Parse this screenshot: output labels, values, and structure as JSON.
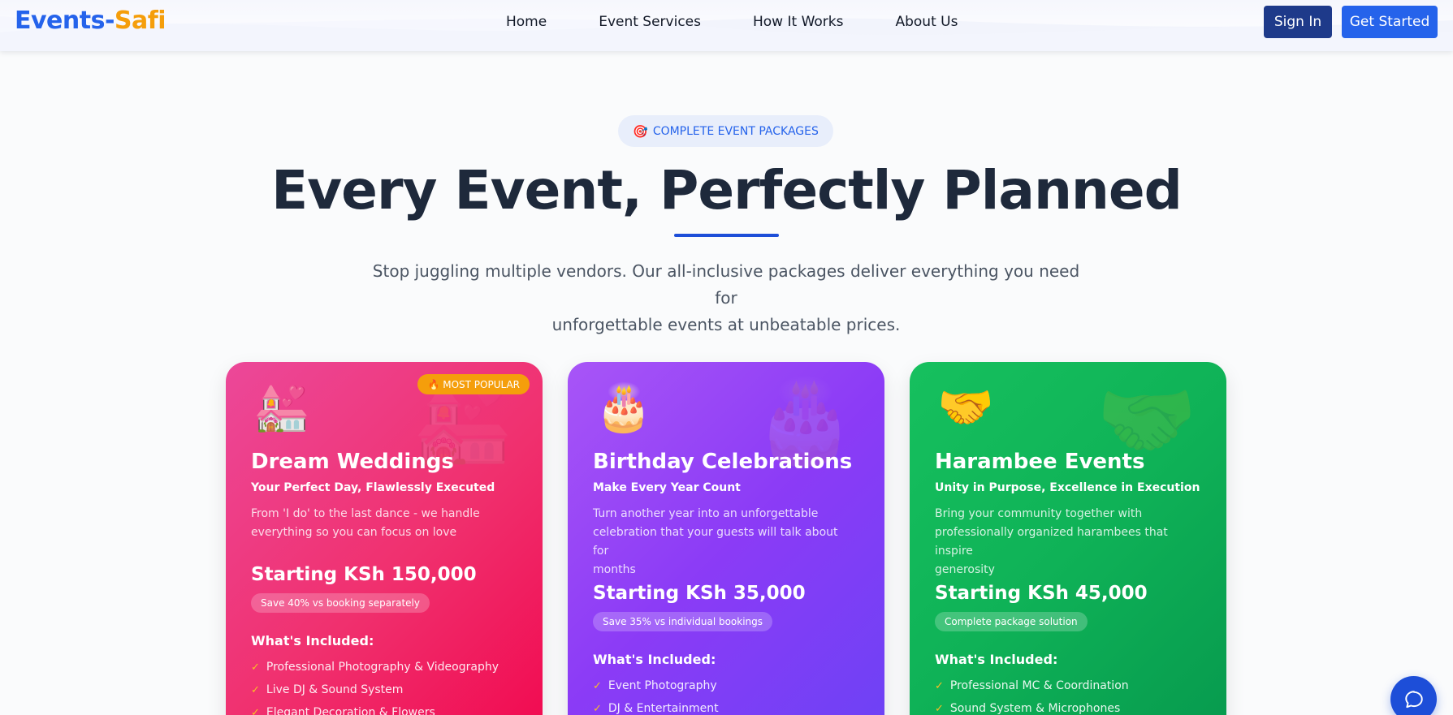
{
  "nav": {
    "logo_part1": "Events-",
    "logo_part2": "Safi",
    "links": [
      "Home",
      "Event Services",
      "How It Works",
      "About Us"
    ],
    "sign_in": "Sign In",
    "get_started": "Get Started"
  },
  "hero": {
    "badge_icon": "🎯",
    "badge_text": "COMPLETE EVENT PACKAGES",
    "title": "Every Event, Perfectly Planned",
    "subtitle_line1": "Stop juggling multiple vendors. Our all-inclusive packages deliver everything you need for",
    "subtitle_line2": "unforgettable events at unbeatable prices."
  },
  "cards": [
    {
      "emoji": "💒",
      "badge": "🔥 MOST POPULAR",
      "title": "Dream Weddings",
      "tagline": "Your Perfect Day, Flawlessly Executed",
      "desc_line1": "From 'I do' to the last dance - we handle",
      "desc_line2": "everything so you can focus on love",
      "desc_line3": "",
      "price": "Starting KSh 150,000",
      "save": "Save 40% vs booking separately",
      "included_label": "What's Included:",
      "items": [
        "Professional Photography & Videography",
        "Live DJ & Sound System",
        "Elegant Decoration & Flowers"
      ]
    },
    {
      "emoji": "🎂",
      "badge": "",
      "title": "Birthday Celebrations",
      "tagline": "Make Every Year Count",
      "desc_line1": "Turn another year into an unforgettable",
      "desc_line2": "celebration that your guests will talk about for",
      "desc_line3": "months",
      "price": "Starting KSh 35,000",
      "save": "Save 35% vs individual bookings",
      "included_label": "What's Included:",
      "items": [
        "Event Photography",
        "DJ & Entertainment"
      ]
    },
    {
      "emoji": "🤝",
      "badge": "",
      "title": "Harambee Events",
      "tagline": "Unity in Purpose, Excellence in Execution",
      "desc_line1": "Bring your community together with",
      "desc_line2": "professionally organized harambees that inspire",
      "desc_line3": "generosity",
      "price": "Starting KSh 45,000",
      "save": "Complete package solution",
      "included_label": "What's Included:",
      "items": [
        "Professional MC & Coordination",
        "Sound System & Microphones"
      ]
    }
  ],
  "chat": {
    "icon": "chat-bubble-icon"
  },
  "colors": {
    "primary": "#2563eb",
    "accent": "#f59e0b",
    "wedding": "#f0306e",
    "birthday": "#8b3bf6",
    "harambee": "#0fb257"
  }
}
